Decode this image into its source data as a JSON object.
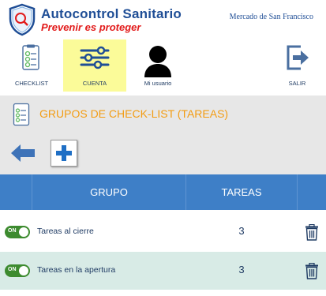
{
  "header": {
    "brand_title": "Autocontrol Sanitario",
    "brand_tagline": "Prevenir es proteger",
    "location": "Mercado de San Francisco"
  },
  "nav": {
    "items": [
      {
        "label": "CHECKLIST",
        "icon": "checklist-icon",
        "active": false
      },
      {
        "label": "CUENTA",
        "icon": "sliders-icon",
        "active": true
      },
      {
        "label": "Mi usuario",
        "icon": "user-icon",
        "active": false
      },
      {
        "label": "SALIR",
        "icon": "exit-icon",
        "active": false
      }
    ]
  },
  "section": {
    "title": "GRUPOS DE CHECK-LIST (TAREAS)"
  },
  "table": {
    "columns": [
      "GRUPO",
      "TAREAS"
    ],
    "rows": [
      {
        "toggle": "ON",
        "name": "Tareas al cierre",
        "tareas": "3"
      },
      {
        "toggle": "ON",
        "name": "Tareas en la apertura",
        "tareas": "3"
      }
    ]
  },
  "colors": {
    "brand_blue": "#1f4e96",
    "tagline_red": "#e21b1b",
    "section_orange": "#f39c12",
    "table_header": "#3e7fc7",
    "active_tab": "#fbfb99",
    "toggle_on": "#3d8b2f",
    "row_alt": "#d8ebe6"
  }
}
